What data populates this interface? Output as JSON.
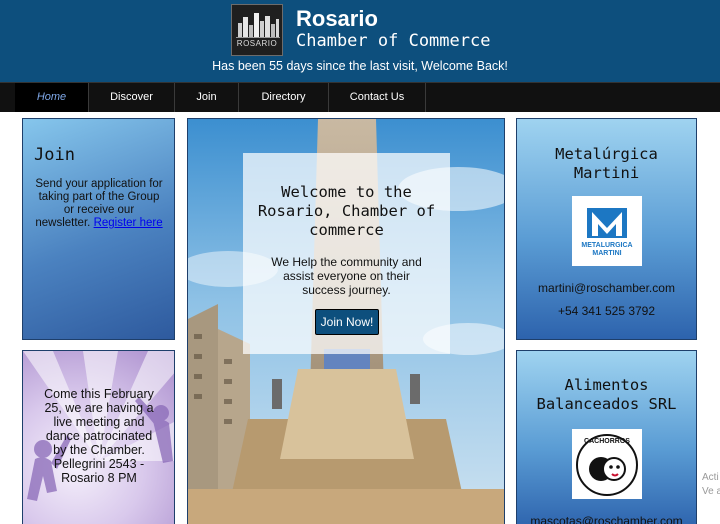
{
  "header": {
    "logo_text": "ROSARIO",
    "title": "Rosario",
    "subtitle": "Chamber of Commerce",
    "visit_message": "Has been 55 days since the last visit, Welcome Back!"
  },
  "nav": {
    "items": [
      {
        "label": "Home",
        "active": true
      },
      {
        "label": "Discover",
        "active": false
      },
      {
        "label": "Join",
        "active": false
      },
      {
        "label": "Directory",
        "active": false
      },
      {
        "label": "Contact Us",
        "active": false
      }
    ]
  },
  "join_card": {
    "title": "Join",
    "text": "Send your application for taking part of the Group or receive our newsletter.",
    "link_label": "Register here"
  },
  "event_card": {
    "text": "Come this February 25, we are having a live meeting and dance patrocinated by the Chamber. Pellegrini 2543 - Rosario 8 PM"
  },
  "hero": {
    "heading": "Welcome to the Rosario, Chamber of commerce",
    "text": "We Help the community and assist everyone on their success journey.",
    "button_label": "Join Now!"
  },
  "businesses": [
    {
      "name": "Metalúrgica Martini",
      "logo_text": "METALURGICA MARTINI",
      "email": "martini@roschamber.com",
      "phone": "+54 341 525 3792"
    },
    {
      "name": "Alimentos Balanceados SRL",
      "logo_text": "CACHORROS",
      "email": "mascotas@roschamber.com"
    }
  ],
  "overlay": {
    "activate_line1": "Acti",
    "activate_line2": "Ve a"
  },
  "colors": {
    "header_bg": "#0d4f7d",
    "nav_bg": "#111111",
    "nav_active_text": "#7fa8e8",
    "card_gradient_top": "#86c6ec",
    "card_gradient_bottom": "#2e5a9e",
    "button_bg": "#0d4f7d"
  }
}
